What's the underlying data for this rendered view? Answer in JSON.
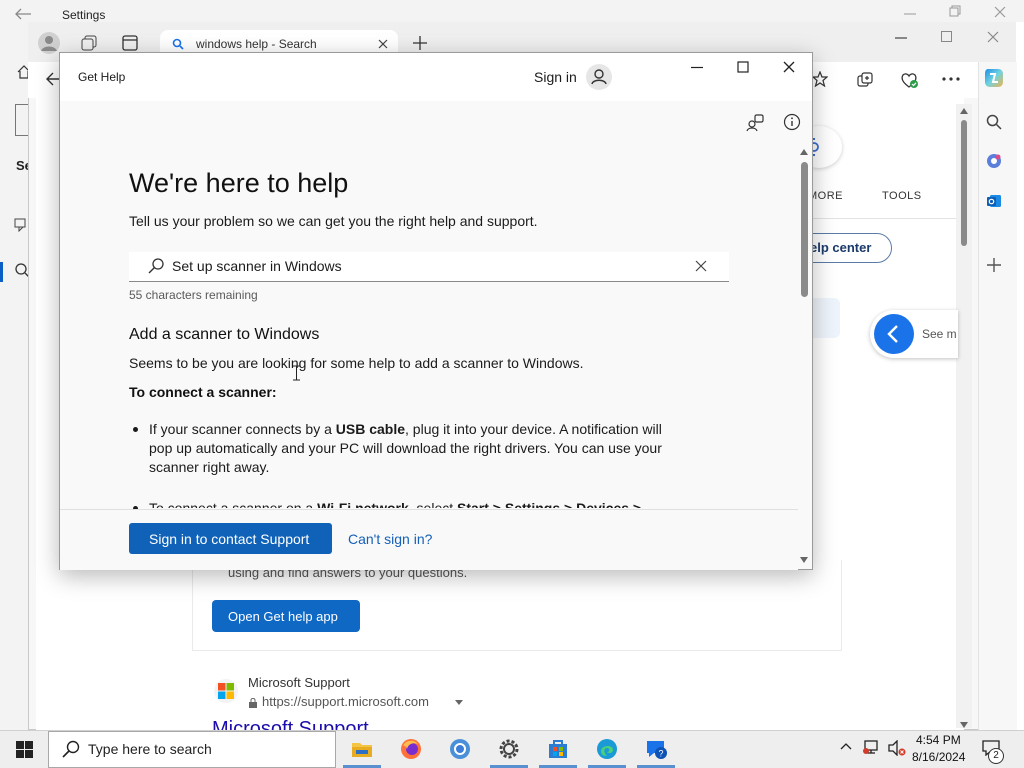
{
  "settings_window": {
    "title": "Settings"
  },
  "edge": {
    "tab_title": "windows help - Search",
    "bing": {
      "tab_more": "MORE",
      "tab_tools": "TOOLS",
      "help_center": "elp center",
      "see_more": "See m",
      "panel_text": "using and find answers to your questions.",
      "open_app_button": "Open Get help app",
      "result_name": "Microsoft Support",
      "result_url": "https://support.microsoft.com",
      "result_title": "Microsoft Support"
    }
  },
  "get_help": {
    "title": "Get Help",
    "sign_in": "Sign in",
    "heading": "We're here to help",
    "subheading": "Tell us your problem so we can get you the right help and support.",
    "search_value": "Set up scanner in Windows",
    "chars_remaining": "55 characters remaining",
    "article_title": "Add a scanner to Windows",
    "article_intro": "Seems to be you are looking for some help to add a scanner to Windows.",
    "connect_heading": "To connect a scanner:",
    "bullet1": {
      "pre": "If your scanner connects by a ",
      "bold": "USB cable",
      "post": ", plug it into your device. A notification will pop up automatically and your PC will download the right drivers. You can use your scanner right away."
    },
    "bullet2": {
      "pre": "To connect a scanner on a ",
      "bold1": "Wi-Fi network",
      "mid": ", select ",
      "bold2": "Start",
      "sep1": " > ",
      "bold3": "Settings",
      "sep2": " > ",
      "bold4": "Devices",
      "sep3": " >"
    },
    "contact_button": "Sign in to contact Support",
    "cant_sign_in": "Can't sign in?"
  },
  "taskbar": {
    "search_placeholder": "Type here to search",
    "apps": [
      "file-explorer-icon",
      "firefox-icon",
      "chrome-icon",
      "settings-icon",
      "store-icon",
      "edge-icon",
      "get-help-icon"
    ],
    "time": "4:54 PM",
    "date": "8/16/2024",
    "notifications": "2"
  },
  "colors": {
    "accent": "#0f62b8",
    "link": "#1560b8",
    "bing_accent": "#1a73e8"
  }
}
